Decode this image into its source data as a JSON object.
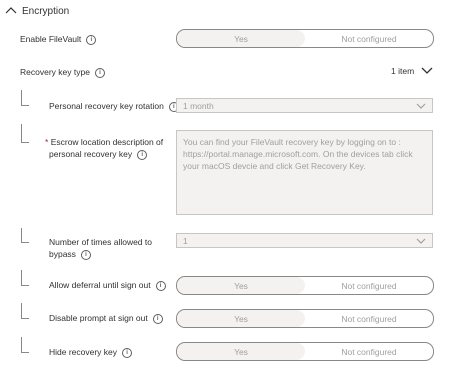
{
  "section": {
    "title": "Encryption",
    "icon": "chevron-up-icon"
  },
  "enable_filevault": {
    "label": "Enable FileVault",
    "yes": "Yes",
    "no": "Not configured"
  },
  "recovery_key_type": {
    "label": "Recovery key type",
    "count": "1 item"
  },
  "rotation": {
    "label": "Personal recovery key rotation",
    "value": "1 month"
  },
  "escrow": {
    "required": "*",
    "label_line1": "Escrow location description of",
    "label_line2": "personal recovery key",
    "value": "You can find your FileVault recovery key by logging on to : https://portal.manage.microsoft.com. On the devices tab click your macOS devcie and click Get Recovery Key."
  },
  "bypass": {
    "label_line1": "Number of times allowed to",
    "label_line2": "bypass",
    "value": "1"
  },
  "deferral": {
    "label": "Allow deferral until sign out",
    "yes": "Yes",
    "no": "Not configured"
  },
  "disable_prompt": {
    "label": "Disable prompt at sign out",
    "yes": "Yes",
    "no": "Not configured"
  },
  "hide_key": {
    "label": "Hide recovery key",
    "yes": "Yes",
    "no": "Not configured"
  }
}
